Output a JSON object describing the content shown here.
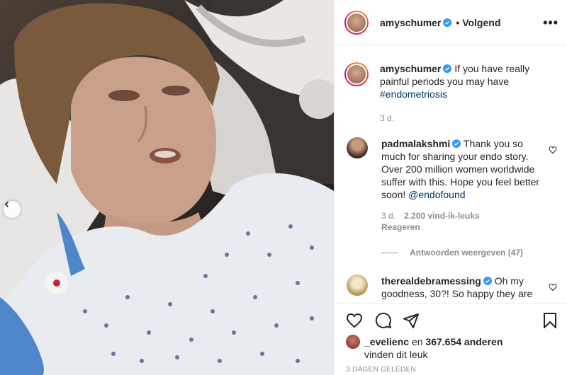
{
  "post": {
    "author": "amyschumer",
    "follow_label": "Volgend",
    "more_label": "•••",
    "caption_text": "If you have really painful periods you may have",
    "caption_hashtag": "#endometriosis",
    "caption_time": "3 d."
  },
  "comments": [
    {
      "username": "padmalakshmi",
      "text": "Thank you so much for sharing your endo story. Over 200 million women worldwide suffer with this. Hope you feel better soon!",
      "mention": "@endofound",
      "time": "3 d.",
      "likes": "2.200 vind-ik-leuks",
      "reply_label": "Reageren",
      "view_replies": "Antwoorden weergeven (47)"
    },
    {
      "username": "therealdebramessing",
      "text": "Oh my goodness, 30?! So happy they are"
    }
  ],
  "likes_summary": {
    "user": "_evelienc",
    "joiner": "en",
    "count_text": "367.654 anderen",
    "suffix": "vinden dit leuk"
  },
  "post_date": "3 DAGEN GELEDEN",
  "icons": {
    "verified": "verified-badge-icon",
    "like": "heart-icon",
    "comment": "comment-bubble-icon",
    "share": "paper-plane-icon",
    "save": "bookmark-icon",
    "prev": "chevron-left-icon"
  },
  "colors": {
    "verified_blue": "#3897f0",
    "link": "#00376b",
    "muted": "#8e8e8e"
  }
}
